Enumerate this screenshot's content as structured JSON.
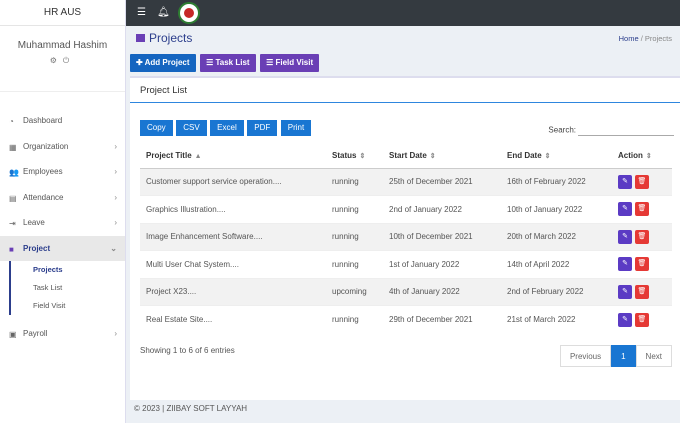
{
  "brand": "HR AUS",
  "user": {
    "name": "Muhammad Hashim"
  },
  "sidebar": {
    "items": [
      {
        "label": "Dashboard",
        "icon": "dashboard-icon"
      },
      {
        "label": "Organization",
        "icon": "building-icon"
      },
      {
        "label": "Employees",
        "icon": "users-icon"
      },
      {
        "label": "Attendance",
        "icon": "calendar-icon"
      },
      {
        "label": "Leave",
        "icon": "exit-icon"
      },
      {
        "label": "Project",
        "icon": "briefcase-icon"
      }
    ],
    "project_sub": [
      {
        "label": "Projects"
      },
      {
        "label": "Task List"
      },
      {
        "label": "Field Visit"
      }
    ],
    "payroll": {
      "label": "Payroll"
    }
  },
  "page": {
    "title": "Projects",
    "breadcrumb_home": "Home",
    "breadcrumb_current": "Projects"
  },
  "actions": {
    "add_project": "Add Project",
    "task_list": "Task List",
    "field_visit": "Field Visit"
  },
  "card": {
    "title": "Project List"
  },
  "exports": {
    "copy": "Copy",
    "csv": "CSV",
    "excel": "Excel",
    "pdf": "PDF",
    "print": "Print"
  },
  "search": {
    "label": "Search:"
  },
  "table": {
    "headers": [
      "Project Title",
      "Status",
      "Start Date",
      "End Date",
      "Action"
    ],
    "rows": [
      {
        "title": "Customer support service operation....",
        "status": "running",
        "start": "25th of December 2021",
        "end": "16th of February 2022"
      },
      {
        "title": "Graphics Illustration....",
        "status": "running",
        "start": "2nd of January 2022",
        "end": "10th of January 2022"
      },
      {
        "title": "Image Enhancement Software....",
        "status": "running",
        "start": "10th of December 2021",
        "end": "20th of March 2022"
      },
      {
        "title": "Multi User Chat System....",
        "status": "running",
        "start": "1st of January 2022",
        "end": "14th of April 2022"
      },
      {
        "title": "Project X23....",
        "status": "upcoming",
        "start": "4th of January 2022",
        "end": "2nd of February 2022"
      },
      {
        "title": "Real Estate Site....",
        "status": "running",
        "start": "29th of December 2021",
        "end": "21st of March 2022"
      }
    ]
  },
  "pagination": {
    "info": "Showing 1 to 6 of 6 entries",
    "previous": "Previous",
    "current": "1",
    "next": "Next"
  },
  "footer": "© 2023 | ZIIBAY SOFT LAYYAH",
  "colors": {
    "primary": "#1565c0",
    "purple": "#6a3fb5",
    "danger": "#e53935",
    "topbar": "#343a40"
  }
}
